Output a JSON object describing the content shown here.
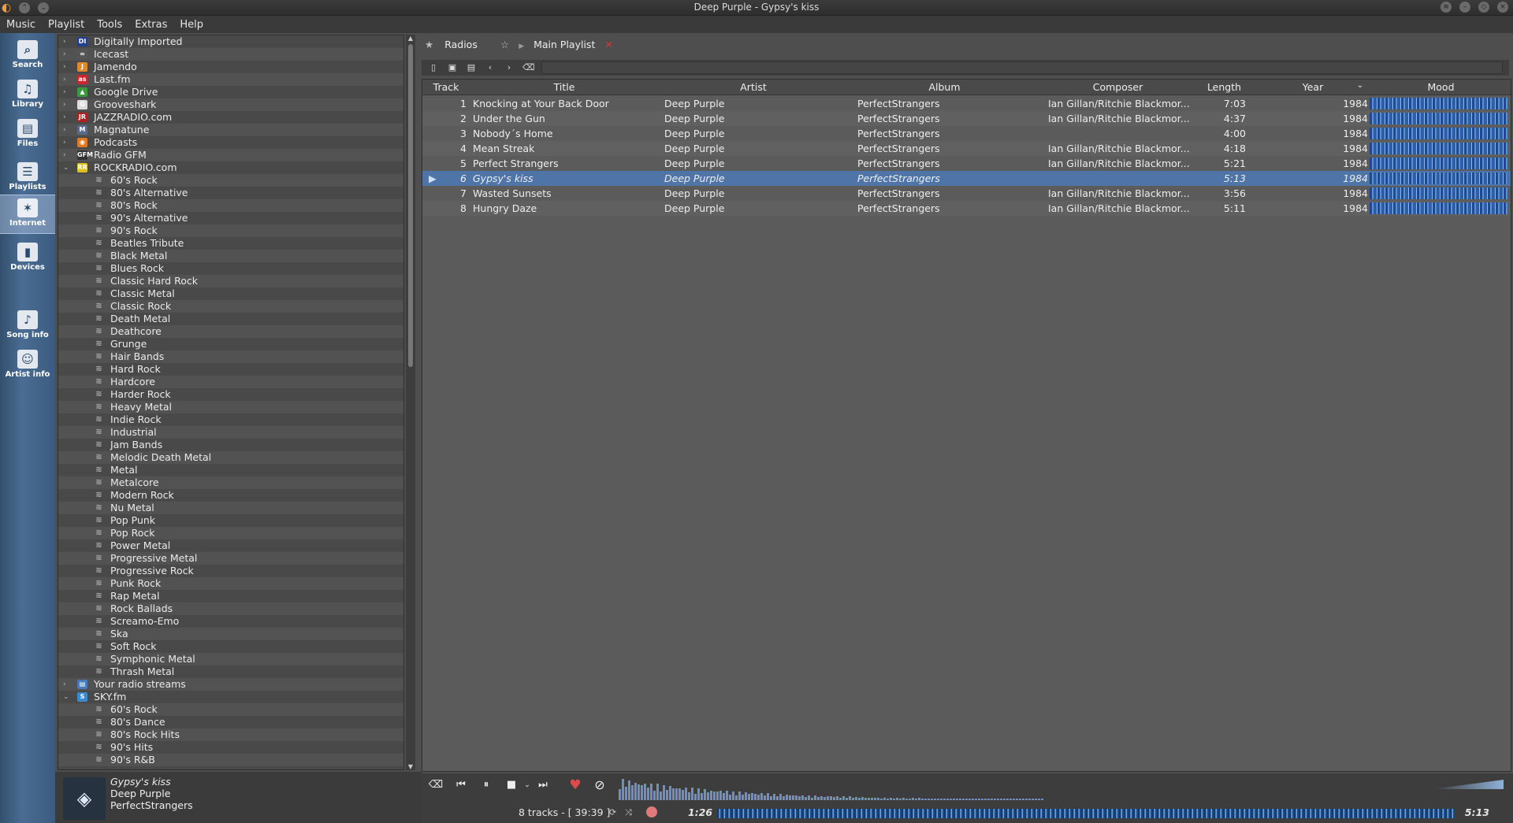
{
  "window": {
    "title": "Deep Purple - Gypsy's kiss"
  },
  "menu": [
    "Music",
    "Playlist",
    "Tools",
    "Extras",
    "Help"
  ],
  "sidebar": [
    {
      "label": "Search",
      "icon": "search-icon"
    },
    {
      "label": "Library",
      "icon": "library-icon"
    },
    {
      "label": "Files",
      "icon": "files-icon"
    },
    {
      "label": "Playlists",
      "icon": "playlists-icon"
    },
    {
      "label": "Internet",
      "icon": "internet-icon",
      "active": true
    },
    {
      "label": "Devices",
      "icon": "devices-icon"
    },
    {
      "label": "Song info",
      "icon": "song-info-icon"
    },
    {
      "label": "Artist info",
      "icon": "artist-info-icon"
    }
  ],
  "tree": {
    "services": [
      {
        "label": "Digitally Imported",
        "color": "#1f3f8f",
        "mark": "DI"
      },
      {
        "label": "Icecast",
        "color": "#555555",
        "mark": "≈"
      },
      {
        "label": "Jamendo",
        "color": "#e08a2a",
        "mark": "J"
      },
      {
        "label": "Last.fm",
        "color": "#d0242c",
        "mark": "as"
      },
      {
        "label": "Google Drive",
        "color": "#3a9a3a",
        "mark": "▲"
      },
      {
        "label": "Grooveshark",
        "color": "#dddddd",
        "mark": "G"
      },
      {
        "label": "JAZZRADIO.com",
        "color": "#b02020",
        "mark": "JR"
      },
      {
        "label": "Magnatune",
        "color": "#5a6a8a",
        "mark": "M"
      },
      {
        "label": "Podcasts",
        "color": "#e07a20",
        "mark": "◉"
      },
      {
        "label": "Radio GFM",
        "color": "#333333",
        "mark": "GFM"
      },
      {
        "label": "ROCKRADIO.com",
        "color": "#e0c020",
        "mark": "RR"
      }
    ],
    "rockradio_stations": [
      "60's Rock",
      "80's Alternative",
      "80's Rock",
      "90's Alternative",
      "90's Rock",
      "Beatles Tribute",
      "Black Metal",
      "Blues Rock",
      "Classic Hard Rock",
      "Classic Metal",
      "Classic Rock",
      "Death Metal",
      "Deathcore",
      "Grunge",
      "Hair Bands",
      "Hard Rock",
      "Hardcore",
      "Harder Rock",
      "Heavy Metal",
      "Indie Rock",
      "Industrial",
      "Jam Bands",
      "Melodic Death Metal",
      "Metal",
      "Metalcore",
      "Modern Rock",
      "Nu Metal",
      "Pop Punk",
      "Pop Rock",
      "Power Metal",
      "Progressive Metal",
      "Progressive Rock",
      "Punk Rock",
      "Rap Metal",
      "Rock Ballads",
      "Screamo-Emo",
      "Ska",
      "Soft Rock",
      "Symphonic Metal",
      "Thrash Metal"
    ],
    "more_services": [
      {
        "label": "Your radio streams",
        "color": "#4a7ab8",
        "mark": "▤"
      },
      {
        "label": "SKY.fm",
        "color": "#3a8ad0",
        "mark": "S"
      }
    ],
    "skyfm_stations": [
      "60's Rock",
      "80's Dance",
      "80's Rock Hits",
      "90's Hits",
      "90's R&B"
    ]
  },
  "now_playing": {
    "title": "Gypsy's kiss",
    "artist": "Deep Purple",
    "album": "PerfectStrangers"
  },
  "tabs": [
    {
      "label": "Radios",
      "icon": "star-icon"
    },
    {
      "label": "Main Playlist",
      "icon": "star-outline-icon"
    }
  ],
  "columns": [
    "Track",
    "Title",
    "Artist",
    "Album",
    "Composer",
    "Length",
    "Year",
    "Mood"
  ],
  "tracks": [
    {
      "n": "1",
      "title": "Knocking at Your Back Door",
      "artist": "Deep Purple",
      "album": "PerfectStrangers",
      "composer": "Ian Gillan/Ritchie Blackmor...",
      "length": "7:03",
      "year": "1984"
    },
    {
      "n": "2",
      "title": "Under the Gun",
      "artist": "Deep Purple",
      "album": "PerfectStrangers",
      "composer": "Ian Gillan/Ritchie Blackmor...",
      "length": "4:37",
      "year": "1984"
    },
    {
      "n": "3",
      "title": "Nobody´s Home",
      "artist": "Deep Purple",
      "album": "PerfectStrangers",
      "composer": "",
      "length": "4:00",
      "year": "1984"
    },
    {
      "n": "4",
      "title": "Mean Streak",
      "artist": "Deep Purple",
      "album": "PerfectStrangers",
      "composer": "Ian Gillan/Ritchie Blackmor...",
      "length": "4:18",
      "year": "1984"
    },
    {
      "n": "5",
      "title": "Perfect Strangers",
      "artist": "Deep Purple",
      "album": "PerfectStrangers",
      "composer": "Ian Gillan/Ritchie Blackmor...",
      "length": "5:21",
      "year": "1984"
    },
    {
      "n": "6",
      "title": "Gypsy's kiss",
      "artist": "Deep Purple",
      "album": "PerfectStrangers",
      "composer": "",
      "length": "5:13",
      "year": "1984",
      "current": true
    },
    {
      "n": "7",
      "title": "Wasted Sunsets",
      "artist": "Deep Purple",
      "album": "PerfectStrangers",
      "composer": "Ian Gillan/Ritchie Blackmor...",
      "length": "3:56",
      "year": "1984"
    },
    {
      "n": "8",
      "title": "Hungry Daze",
      "artist": "Deep Purple",
      "album": "PerfectStrangers",
      "composer": "Ian Gillan/Ritchie Blackmor...",
      "length": "5:11",
      "year": "1984"
    }
  ],
  "status": {
    "tracks_summary": "8 tracks - [ 39:39 ]",
    "elapsed": "1:26",
    "total": "5:13"
  },
  "colors": {
    "accent": "#4f75a8",
    "sidebar": "#4a6d93",
    "love": "#e04a4a"
  }
}
